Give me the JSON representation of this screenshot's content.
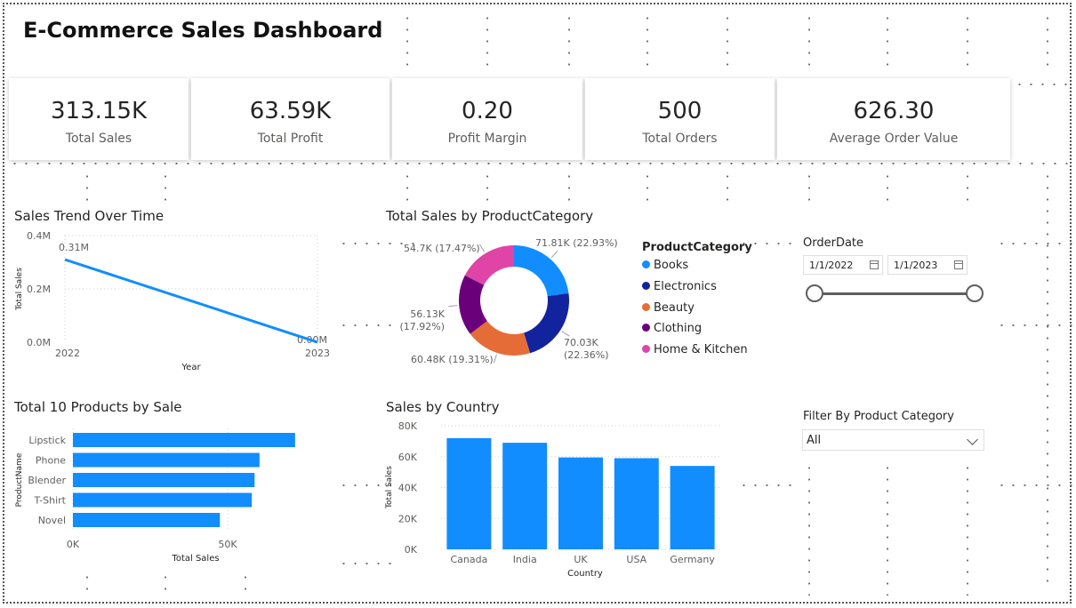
{
  "dashboard": {
    "title": "E-Commerce Sales Dashboard"
  },
  "cards": [
    {
      "value": "313.15K",
      "label": "Total Sales"
    },
    {
      "value": "63.59K",
      "label": "Total Profit"
    },
    {
      "value": "0.20",
      "label": "Profit Margin"
    },
    {
      "value": "500",
      "label": "Total Orders"
    },
    {
      "value": "626.30",
      "label": "Average Order Value"
    }
  ],
  "visuals": {
    "trend_title": "Sales Trend Over Time",
    "donut_title": "Total Sales by ProductCategory",
    "top_title": "Total 10 Products by Sale",
    "country_title": "Sales by Country"
  },
  "legend": {
    "title": "ProductCategory",
    "items": [
      {
        "label": "Books",
        "color": "#118DFF"
      },
      {
        "label": "Electronics",
        "color": "#12239E"
      },
      {
        "label": "Beauty",
        "color": "#E66C37"
      },
      {
        "label": "Clothing",
        "color": "#6B007B"
      },
      {
        "label": "Home & Kitchen",
        "color": "#E044A7"
      }
    ]
  },
  "slicers": {
    "date_title": "OrderDate",
    "date_start": "1/1/2022",
    "date_end": "1/1/2023",
    "category_title": "Filter By Product Category",
    "category_value": "All"
  },
  "chart_data": [
    {
      "type": "line",
      "title": "Sales Trend Over Time",
      "xlabel": "Year",
      "ylabel": "Total Sales",
      "x": [
        "2022",
        "2023"
      ],
      "values": [
        0.31,
        0.0
      ],
      "data_labels": [
        "0.31M",
        "0.00M"
      ],
      "yticks": [
        "0.0M",
        "0.2M",
        "0.4M"
      ],
      "ylim": [
        0,
        0.4
      ],
      "color": "#118DFF"
    },
    {
      "type": "pie",
      "title": "Total Sales by ProductCategory",
      "categories": [
        "Books",
        "Electronics",
        "Beauty",
        "Clothing",
        "Home & Kitchen"
      ],
      "values": [
        71.81,
        70.03,
        60.48,
        56.13,
        54.7
      ],
      "data_labels": [
        [
          "71.81K (22.93%)"
        ],
        [
          "70.03K",
          "(22.36%)"
        ],
        [
          "60.48K (19.31%)"
        ],
        [
          "56.13K",
          "(17.92%)"
        ],
        [
          "54.7K (17.47%)"
        ]
      ],
      "colors": [
        "#118DFF",
        "#12239E",
        "#E66C37",
        "#6B007B",
        "#E044A7"
      ]
    },
    {
      "type": "bar",
      "title": "Total 10 Products by Sale",
      "xlabel": "Total Sales",
      "ylabel": "ProductName",
      "categories": [
        "Lipstick",
        "Phone",
        "Blender",
        "T-Shirt",
        "Novel"
      ],
      "values": [
        71.8,
        60.3,
        58.7,
        57.8,
        47.5
      ],
      "xticks": [
        "0K",
        "50K"
      ],
      "xlim": [
        0,
        75
      ],
      "color": "#118DFF"
    },
    {
      "type": "bar",
      "title": "Sales by Country",
      "xlabel": "Country",
      "ylabel": "Total Sales",
      "categories": [
        "Canada",
        "India",
        "UK",
        "USA",
        "Germany"
      ],
      "values": [
        72,
        69,
        59.5,
        59,
        54
      ],
      "yticks": [
        "0K",
        "20K",
        "40K",
        "60K",
        "80K"
      ],
      "ylim": [
        0,
        80
      ],
      "color": "#118DFF"
    }
  ]
}
